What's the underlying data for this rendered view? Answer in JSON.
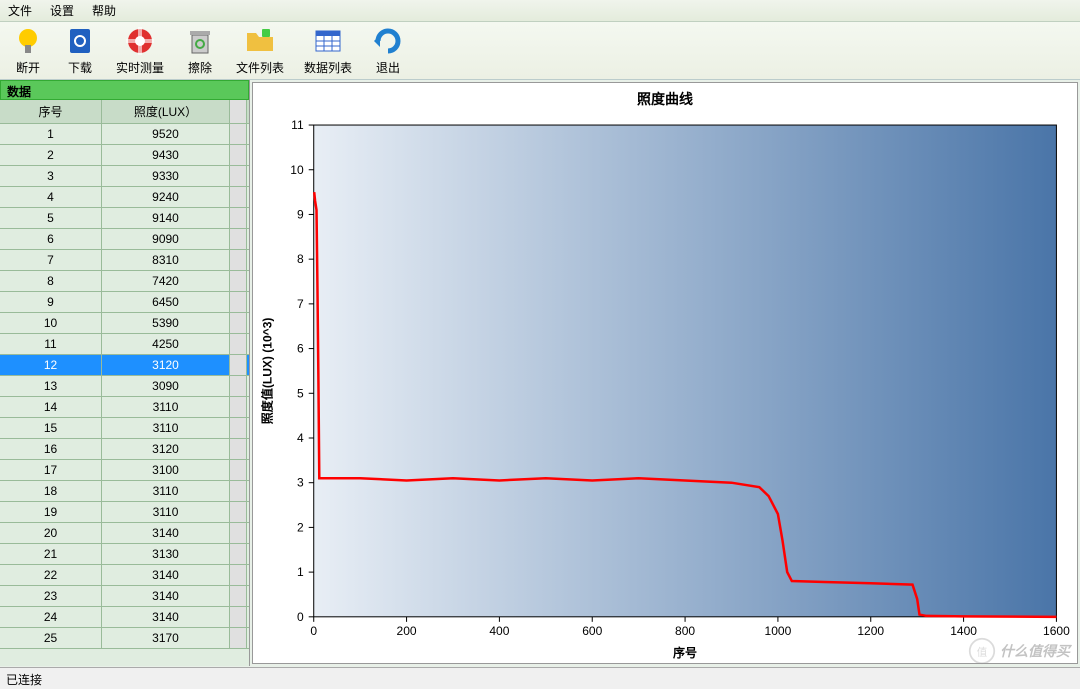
{
  "menu": {
    "file": "文件",
    "settings": "设置",
    "help": "帮助"
  },
  "toolbar": {
    "disconnect": "断开",
    "download": "下载",
    "realtime": "实时测量",
    "clear": "擦除",
    "filelist": "文件列表",
    "datalist": "数据列表",
    "exit": "退出"
  },
  "panel_title": "数据",
  "columns": {
    "idx": "序号",
    "val": "照度(LUX）"
  },
  "selected_row": 12,
  "rows": [
    {
      "idx": 1,
      "val": 9520
    },
    {
      "idx": 2,
      "val": 9430
    },
    {
      "idx": 3,
      "val": 9330
    },
    {
      "idx": 4,
      "val": 9240
    },
    {
      "idx": 5,
      "val": 9140
    },
    {
      "idx": 6,
      "val": 9090
    },
    {
      "idx": 7,
      "val": 8310
    },
    {
      "idx": 8,
      "val": 7420
    },
    {
      "idx": 9,
      "val": 6450
    },
    {
      "idx": 10,
      "val": 5390
    },
    {
      "idx": 11,
      "val": 4250
    },
    {
      "idx": 12,
      "val": 3120
    },
    {
      "idx": 13,
      "val": 3090
    },
    {
      "idx": 14,
      "val": 3110
    },
    {
      "idx": 15,
      "val": 3110
    },
    {
      "idx": 16,
      "val": 3120
    },
    {
      "idx": 17,
      "val": 3100
    },
    {
      "idx": 18,
      "val": 3110
    },
    {
      "idx": 19,
      "val": 3110
    },
    {
      "idx": 20,
      "val": 3140
    },
    {
      "idx": 21,
      "val": 3130
    },
    {
      "idx": 22,
      "val": 3140
    },
    {
      "idx": 23,
      "val": 3140
    },
    {
      "idx": 24,
      "val": 3140
    },
    {
      "idx": 25,
      "val": 3170
    }
  ],
  "status": "已连接",
  "watermark": "什么值得买",
  "chart_data": {
    "type": "line",
    "title": "照度曲线",
    "xlabel": "序号",
    "ylabel": "照度值(LUX) (10^3)",
    "xlim": [
      0,
      1600
    ],
    "ylim": [
      0,
      11
    ],
    "xticks": [
      0,
      200,
      400,
      600,
      800,
      1000,
      1200,
      1400,
      1600
    ],
    "yticks": [
      0,
      1,
      2,
      3,
      4,
      5,
      6,
      7,
      8,
      9,
      10,
      11
    ],
    "series": [
      {
        "name": "照度",
        "color": "#ff0000",
        "points": [
          {
            "x": 1,
            "y": 9.5
          },
          {
            "x": 3,
            "y": 9.3
          },
          {
            "x": 6,
            "y": 9.1
          },
          {
            "x": 8,
            "y": 7.4
          },
          {
            "x": 10,
            "y": 5.4
          },
          {
            "x": 12,
            "y": 3.1
          },
          {
            "x": 15,
            "y": 3.1
          },
          {
            "x": 20,
            "y": 3.1
          },
          {
            "x": 50,
            "y": 3.1
          },
          {
            "x": 100,
            "y": 3.1
          },
          {
            "x": 200,
            "y": 3.05
          },
          {
            "x": 300,
            "y": 3.1
          },
          {
            "x": 400,
            "y": 3.05
          },
          {
            "x": 500,
            "y": 3.1
          },
          {
            "x": 600,
            "y": 3.05
          },
          {
            "x": 700,
            "y": 3.1
          },
          {
            "x": 800,
            "y": 3.05
          },
          {
            "x": 900,
            "y": 3.0
          },
          {
            "x": 960,
            "y": 2.9
          },
          {
            "x": 980,
            "y": 2.7
          },
          {
            "x": 1000,
            "y": 2.3
          },
          {
            "x": 1010,
            "y": 1.7
          },
          {
            "x": 1020,
            "y": 1.0
          },
          {
            "x": 1030,
            "y": 0.8
          },
          {
            "x": 1100,
            "y": 0.78
          },
          {
            "x": 1200,
            "y": 0.75
          },
          {
            "x": 1290,
            "y": 0.72
          },
          {
            "x": 1300,
            "y": 0.4
          },
          {
            "x": 1305,
            "y": 0.05
          },
          {
            "x": 1320,
            "y": 0.02
          },
          {
            "x": 1400,
            "y": 0.01
          },
          {
            "x": 1600,
            "y": 0.0
          }
        ]
      }
    ]
  }
}
